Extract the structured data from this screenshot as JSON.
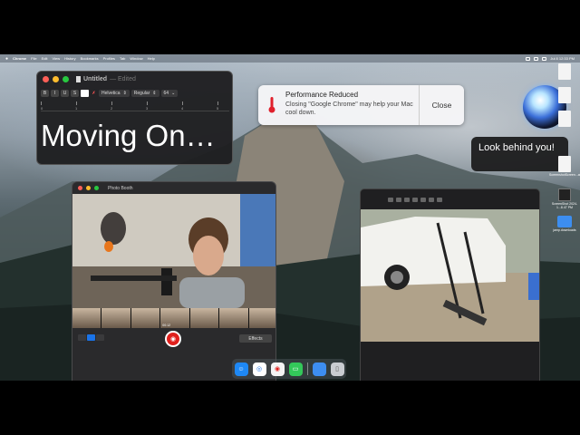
{
  "menubar": {
    "apple_icon": "apple-logo-icon",
    "items": [
      "Chrome",
      "File",
      "Edit",
      "View",
      "History",
      "Bookmarks",
      "Profiles",
      "Tab",
      "Window",
      "Help"
    ],
    "clock": "Jul 8 12:33 PM"
  },
  "textedit": {
    "title": "Untitled",
    "edited": "— Edited",
    "toolbar": {
      "bold": "B",
      "italic": "I",
      "underline": "U",
      "strike": "S",
      "font": "Helvetica",
      "style": "Regular",
      "size": "64"
    },
    "ruler": [
      "0",
      "1",
      "2",
      "3",
      "4",
      "5"
    ],
    "content": "Moving On…"
  },
  "notification": {
    "icon": "thermometer-icon",
    "title": "Performance Reduced",
    "message": "Closing \"Google Chrome\" may help your Mac cool down.",
    "close_label": "Close"
  },
  "siri": {
    "bubble_text": "Look behind you!"
  },
  "desktop": {
    "items": [
      {
        "label": "",
        "kind": "doc"
      },
      {
        "label": "",
        "kind": "doc"
      },
      {
        "label": "",
        "kind": "doc"
      },
      {
        "label": "ScreenshotScreen...at...",
        "kind": "doc"
      },
      {
        "label": "ScreenShot 2024-1...8.47 PM",
        "kind": "thumb"
      },
      {
        "label": "jamp.downloads",
        "kind": "folder"
      }
    ]
  },
  "photobooth": {
    "title": "Photo Booth",
    "thumb_label": "00:12",
    "effects_label": "Effects",
    "shutter_icon": "camera-icon"
  },
  "dock": {
    "apps": [
      {
        "name": "finder-icon",
        "color": "#1e88f5"
      },
      {
        "name": "chrome-icon",
        "color": "#ffffff"
      },
      {
        "name": "photo-booth-icon",
        "color": "#f4f4f4"
      },
      {
        "name": "messages-icon",
        "color": "#33c85a"
      },
      {
        "name": "downloads-folder-icon",
        "color": "#3d8ef0"
      },
      {
        "name": "trash-icon",
        "color": "#c8ccd0"
      }
    ]
  }
}
